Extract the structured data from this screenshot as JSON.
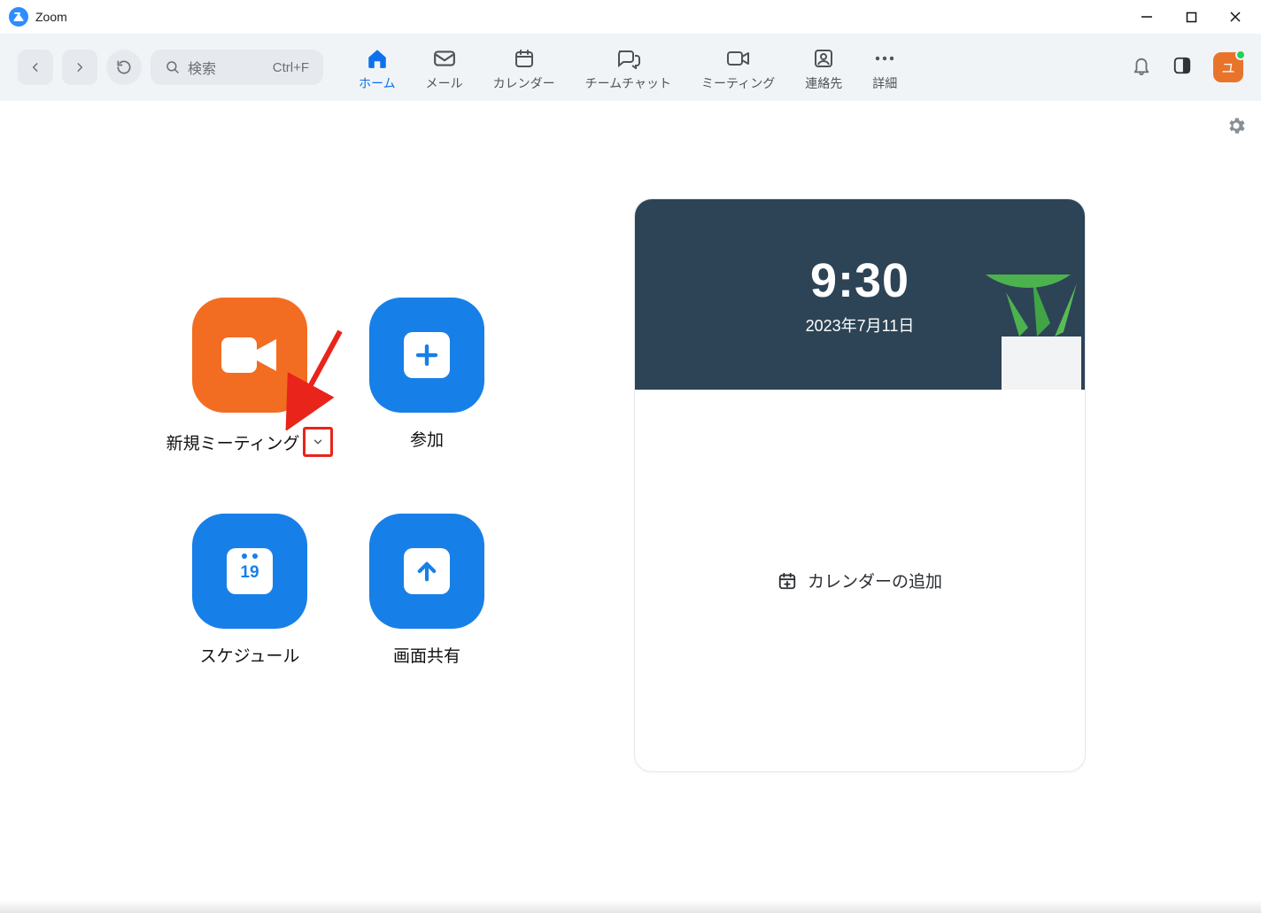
{
  "window": {
    "title": "Zoom"
  },
  "toolbar": {
    "search_placeholder": "検索",
    "search_shortcut": "Ctrl+F",
    "nav": {
      "home": "ホーム",
      "mail": "メール",
      "calendar": "カレンダー",
      "team_chat": "チームチャット",
      "meetings": "ミーティング",
      "contacts": "連絡先",
      "more": "詳細"
    },
    "avatar_initial": "ユ"
  },
  "home_tiles": {
    "new_meeting": "新規ミーティング",
    "join": "参加",
    "schedule": "スケジュール",
    "share": "画面共有",
    "schedule_day_number": "19"
  },
  "clock_card": {
    "time": "9:30",
    "date": "2023年7月11日",
    "add_calendar": "カレンダーの追加"
  }
}
